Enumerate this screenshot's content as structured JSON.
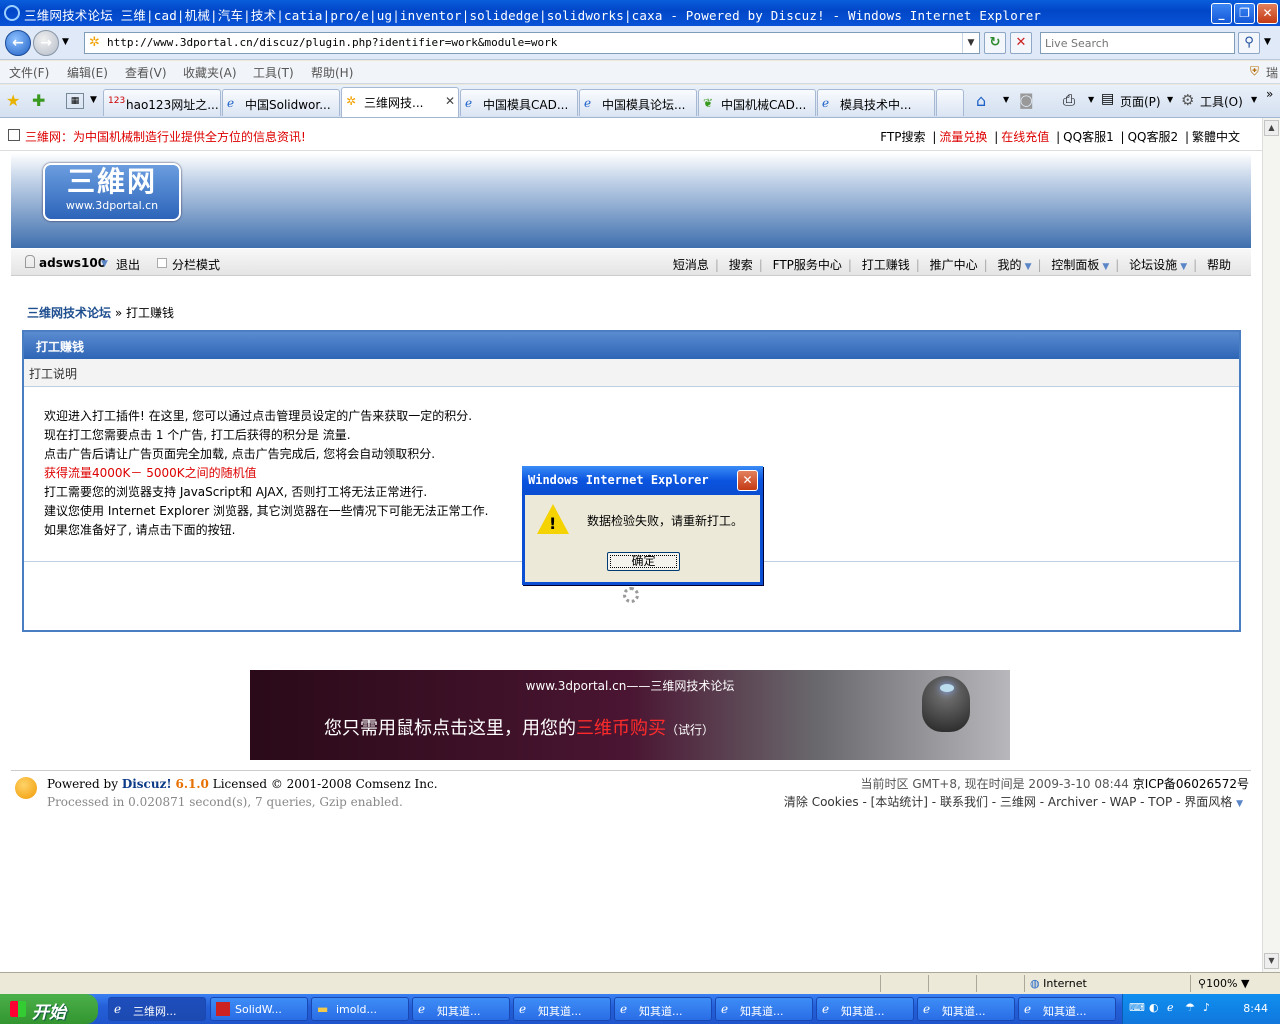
{
  "window": {
    "title": "三维网技术论坛 三维|cad|机械|汽车|技术|catia|pro/e|ug|inventor|solidedge|solidworks|caxa - Powered by Discuz! - Windows Internet Explorer",
    "min": "_",
    "max": "❐",
    "close": "✕"
  },
  "address": {
    "url": "http://www.3dportal.cn/discuz/plugin.php?identifier=work&module=work",
    "search_placeholder": "Live Search"
  },
  "menu": [
    "文件(F)",
    "编辑(E)",
    "查看(V)",
    "收藏夹(A)",
    "工具(T)",
    "帮助(H)"
  ],
  "menu_right": "瑞",
  "tabs": [
    {
      "label": "hao123网址之..."
    },
    {
      "label": "中国Solidwor..."
    },
    {
      "label": "三维网技..."
    },
    {
      "label": "中国模具CAD..."
    },
    {
      "label": "中国模具论坛..."
    },
    {
      "label": "中国机械CAD..."
    },
    {
      "label": "模具技术中..."
    }
  ],
  "tab_close": "✕",
  "toolbar_right": {
    "page": "页面(P)",
    "tools": "工具(O)"
  },
  "site": {
    "slogan": "三維网：为中国机械制造行业提供全方位的信息资讯!",
    "top_links": [
      "FTP搜索",
      "流量兑换",
      "在线充值",
      "QQ客服1",
      "QQ客服2",
      "繁體中文"
    ],
    "logo_big": "三維网",
    "logo_small": "www.3dportal.cn",
    "username": "adsws100",
    "logout": "退出",
    "split_mode": "分栏模式",
    "nav": [
      "短消息",
      "搜索",
      "FTP服务中心",
      "打工赚钱",
      "推广中心",
      "我的",
      "控制面板",
      "论坛设施",
      "帮助"
    ],
    "crumb_home": "三维网技术论坛",
    "crumb_sep": "»",
    "crumb_current": "打工赚钱"
  },
  "work": {
    "header": "打工赚钱",
    "subheader": "打工说明",
    "lines": [
      "欢迎进入打工插件! 在这里, 您可以通过点击管理员设定的广告来获取一定的积分.",
      "现在打工您需要点击 1 个广告, 打工后获得的积分是 流量.",
      "点击广告后请让广告页面完全加载, 点击广告完成后, 您将会自动领取积分.",
      "获得流量4000K－ 5000K之间的随机值",
      "打工需要您的浏览器支持 JavaScript和 AJAX, 否则打工将无法正常进行.",
      "建议您使用 Internet Explorer 浏览器, 其它浏览器在一些情况下可能无法正常工作.",
      "如果您准备好了, 请点击下面的按钮."
    ]
  },
  "banner": {
    "line1": "www.3dportal.cn——三维网技术论坛",
    "line2_pre": "您只需用鼠标点击这里，用您的",
    "line2_hl": "三维币购买",
    "line2_post": "（试行）"
  },
  "footer": {
    "powered_by": "Powered by",
    "discuz": "Discuz!",
    "version": "6.1.0",
    "licensed": "Licensed © 2001-2008 Comsenz Inc.",
    "processed": "Processed in 0.020871 second(s), 7 queries, Gzip enabled.",
    "time_info": "当前时区  GMT+8, 现在时间是  2009-3-10 08:44",
    "icp": "京ICP备06026572号",
    "links": "清除  Cookies - [本站统计] - 联系我们  - 三维网  - Archiver - WAP - TOP - 界面风格"
  },
  "dialog": {
    "title": "Windows Internet Explorer",
    "message": "数据检验失败，请重新打工。",
    "ok": "确定",
    "close": "✕"
  },
  "status": {
    "zone": "Internet",
    "zoom": "100%"
  },
  "taskbar": {
    "start": "开始",
    "tasks": [
      "三维网...",
      "SolidW...",
      "imold...",
      "知其道...",
      "知其道...",
      "知其道...",
      "知其道...",
      "知其道...",
      "知其道...",
      "知其道..."
    ],
    "clock": "8:44"
  }
}
